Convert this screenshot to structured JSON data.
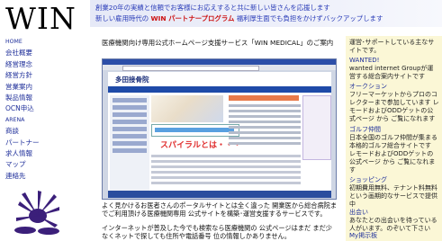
{
  "logo": {
    "text": "WIN"
  },
  "banner": {
    "line1": "創業20年の実績と信頼でお客様にお応えすると共に新しい皆さんを応援します",
    "line2_pre": "新しい雇用時代の ",
    "line2_brand": "WIN パートナープログラム",
    "line2_post": " 福利厚生面でも負担をかけずバックアップします"
  },
  "nav": {
    "items": [
      {
        "label": "HOME",
        "small": true
      },
      {
        "label": "会社概要"
      },
      {
        "label": "経営理念"
      },
      {
        "label": "経営方針"
      },
      {
        "label": "営業案内"
      },
      {
        "label": "製品情報"
      },
      {
        "label": "OCN申込"
      },
      {
        "label": "ARENA",
        "small": true
      },
      {
        "label": "商談"
      },
      {
        "label": "パートナー"
      },
      {
        "label": "求人情報"
      },
      {
        "label": "マップ"
      },
      {
        "label": "連絡先"
      }
    ]
  },
  "main": {
    "title": "医療機関向け専用公式ホームページ支援サービス「WIN MEDICAL」のご案内",
    "screenshot": {
      "hospital_name": "多田接骨院",
      "spiral_text": "スパイラルとは・・・"
    },
    "desc1": "よく見かけるお医者さんのポータルサイトとは全く違った 開業医から総合病院までご利用頂ける医療機関専用 公式サイトを構築･運営支援するサービスです。",
    "desc2": "インターネットが普及した今でも検索なら医療機関の 公式ページはまだ まだ少なくネットで探しても住所や電話番号 位の情報しかありません。"
  },
  "right": {
    "block1": {
      "text": "運営･サポートしている主なサイトです。"
    },
    "block2": {
      "heading": "WANTED!",
      "text": "wanted internet Groupが運営する総合案内サイトです"
    },
    "block3": {
      "heading": "オークション",
      "text": "フリーマーケットからプロのコレクターまで参加しています レモードおよびODDゲットの公式ページ から ご覧になれます"
    },
    "block4": {
      "heading": "ゴルフ仲間",
      "text": "日本全国のゴルフ仲間が集まる 本格的ゴルフ総合サイトです レモードおよびODDゲットの公式ページ から ご覧になれます"
    },
    "block5": {
      "heading": "ショッピング",
      "text": "初期費用無料、テナント料無料という画期的なサービスで提供中"
    },
    "block6": {
      "heading": "出会い",
      "text": "あなたとの出会いを待っている人がいます。のぞいて下さい"
    },
    "block7": {
      "heading": "My掲示板"
    }
  },
  "colors": {
    "nav_link": "#1f2f9a",
    "banner_text": "#2a3cb8",
    "brand_red": "#cc1111",
    "right_bg": "#fbf7d6"
  }
}
